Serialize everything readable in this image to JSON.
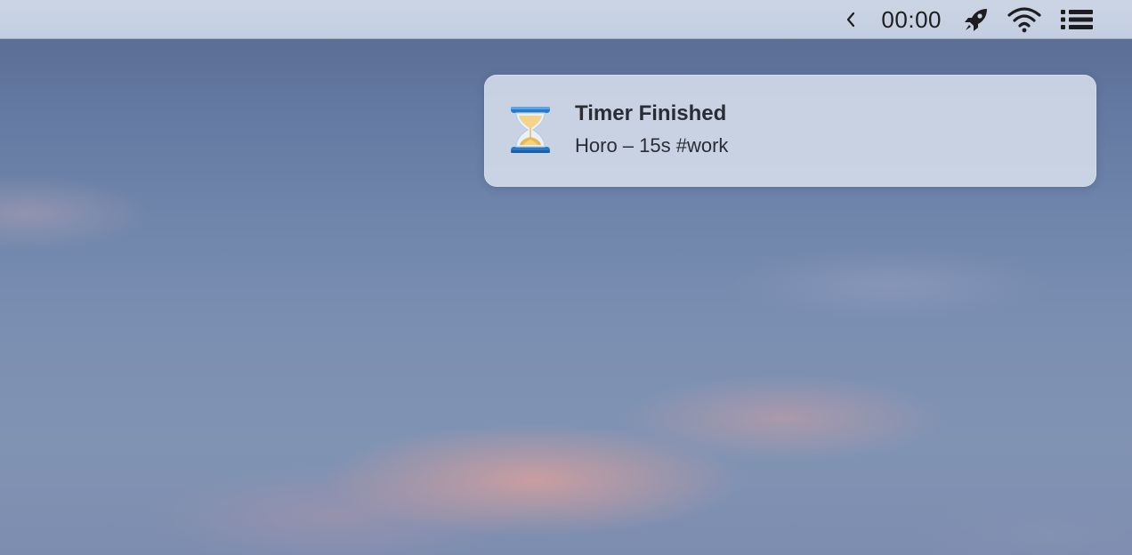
{
  "menubar": {
    "back_icon": "chevron-left-icon",
    "clock_text": "00:00",
    "rocket_icon": "rocket-icon",
    "wifi_icon": "wifi-icon",
    "list_icon": "list-icon"
  },
  "notification": {
    "icon": "hourglass-icon",
    "title": "Timer Finished",
    "body": "Horo – 15s #work"
  },
  "colors": {
    "menubar_bg": "#c7d1e2",
    "notification_bg": "#d6deec",
    "sky_top": "#56688d",
    "cloud_pink": "#d6a09e",
    "text_dark": "#1d1d1f"
  }
}
